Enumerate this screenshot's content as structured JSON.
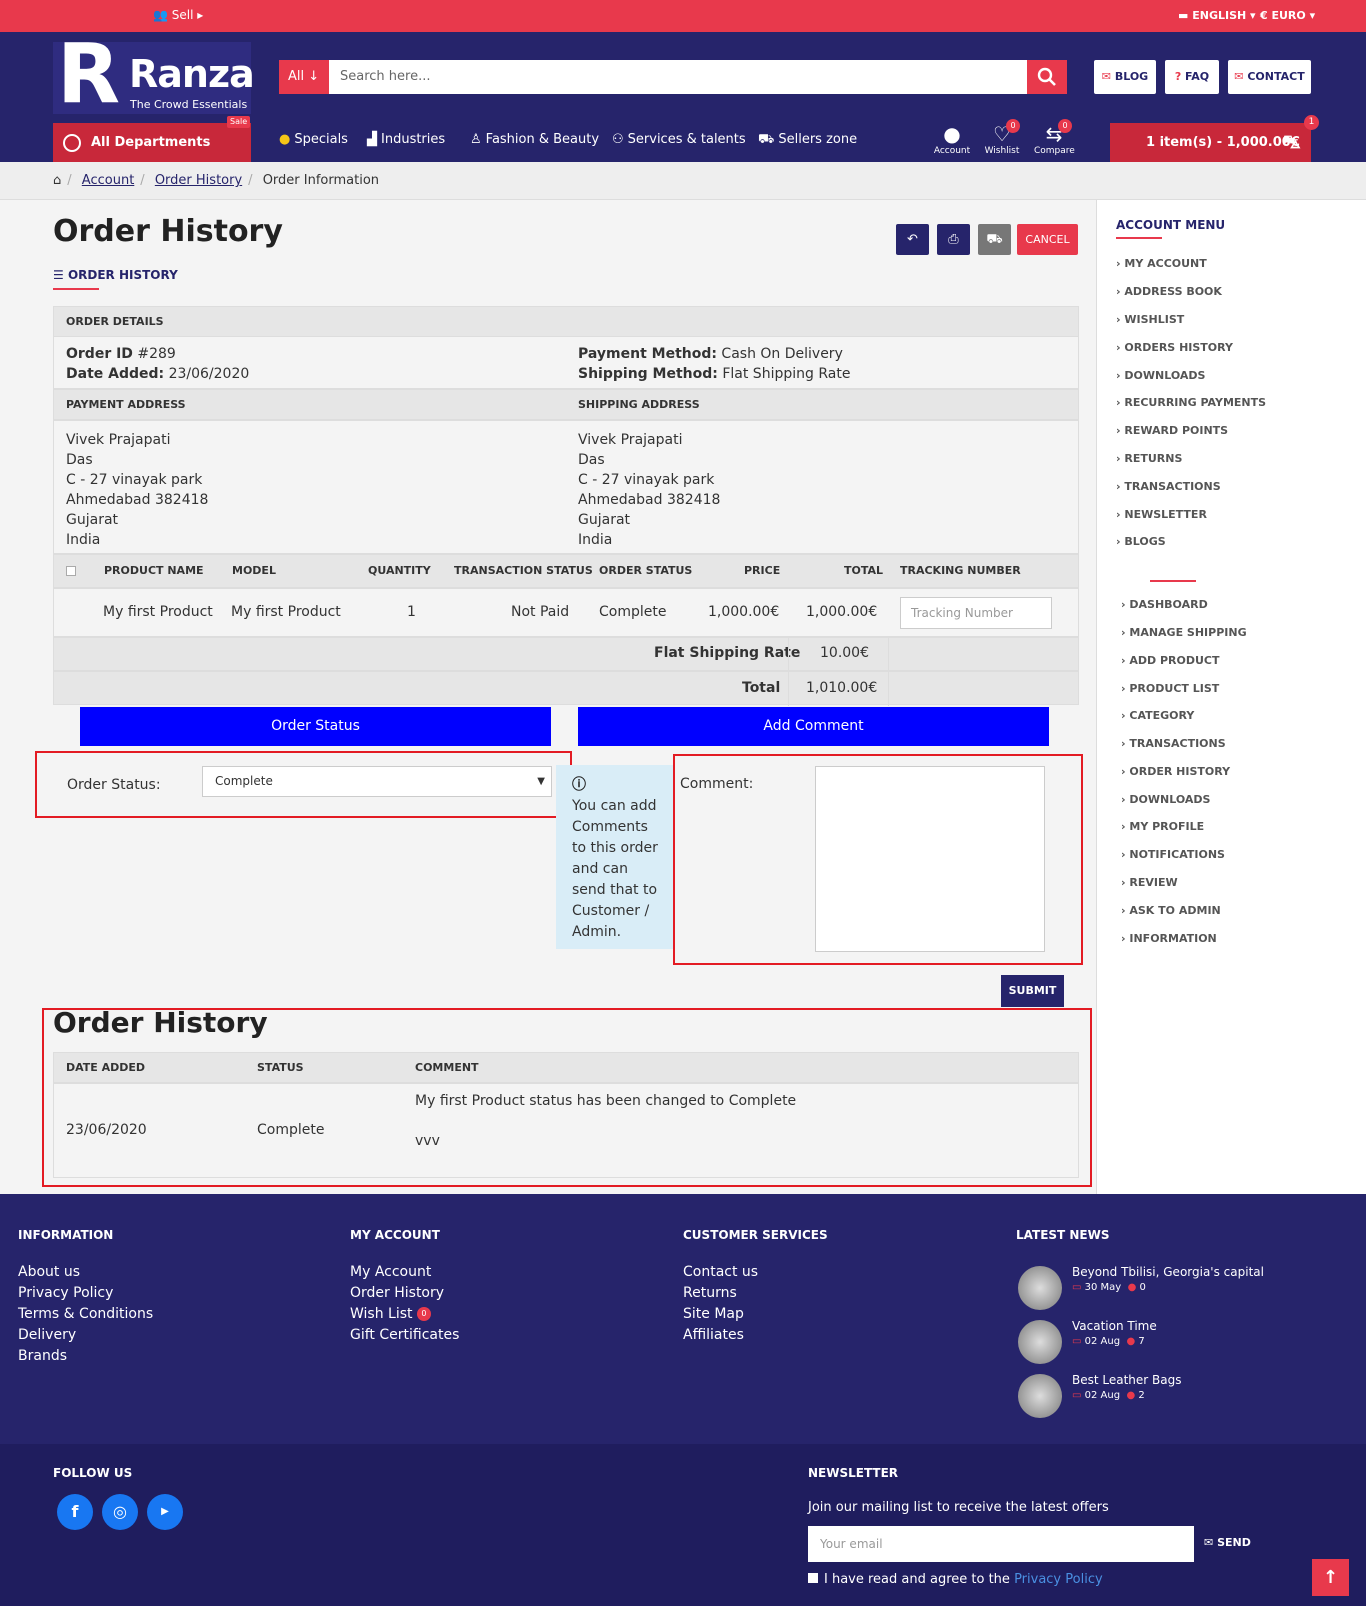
{
  "topbar": {
    "sell": "Sell",
    "language": "ENGLISH",
    "currency": "€ EURO"
  },
  "header": {
    "logo_letter": "R",
    "logo_name": "Ranza",
    "logo_tagline": "The Crowd Essentials",
    "search": {
      "category": "All",
      "placeholder": "Search here..."
    },
    "links": {
      "blog": "BLOG",
      "faq": "FAQ",
      "contact": "CONTACT"
    },
    "all_departments": "All Departments",
    "sale_badge": "Sale",
    "nav": [
      "Specials",
      "Industries",
      "Fashion & Beauty",
      "Services & talents",
      "Sellers zone"
    ],
    "account": "Account",
    "wishlist": "Wishlist",
    "wishlist_count": "0",
    "compare": "Compare",
    "compare_count": "0",
    "cart": "1 item(s) - 1,000.00€",
    "cart_count": "1"
  },
  "breadcrumb": [
    "Account",
    "Order History",
    "Order Information"
  ],
  "page": {
    "title": "Order History",
    "cancel": "CANCEL",
    "section": "ORDER HISTORY",
    "order_details": "ORDER DETAILS",
    "order_id_label": "Order ID",
    "order_id": "#289",
    "date_added_label": "Date Added:",
    "date_added": "23/06/2020",
    "payment_method_label": "Payment Method:",
    "payment_method": "Cash On Delivery",
    "shipping_method_label": "Shipping Method:",
    "shipping_method": "Flat Shipping Rate",
    "payment_address_h": "PAYMENT ADDRESS",
    "shipping_address_h": "SHIPPING ADDRESS",
    "payment_address": [
      "Vivek Prajapati",
      "Das",
      "C - 27 vinayak park",
      "Ahmedabad 382418",
      "Gujarat",
      "India"
    ],
    "shipping_address": [
      "Vivek Prajapati",
      "Das",
      "C - 27 vinayak park",
      "Ahmedabad 382418",
      "Gujarat",
      "India"
    ],
    "columns": [
      "PRODUCT NAME",
      "MODEL",
      "QUANTITY",
      "TRANSACTION STATUS",
      "ORDER STATUS",
      "PRICE",
      "TOTAL",
      "TRACKING NUMBER"
    ],
    "row": {
      "product": "My first Product",
      "model": "My first Product",
      "qty": "1",
      "transaction": "Not Paid",
      "status": "Complete",
      "price": "1,000.00€",
      "total": "1,000.00€",
      "tracking_placeholder": "Tracking Number"
    },
    "shipping_label": "Flat Shipping Rate",
    "shipping_value": "10.00€",
    "total_label": "Total",
    "total_value": "1,010.00€",
    "order_status_btn": "Order Status",
    "add_comment_btn": "Add Comment",
    "order_status_label": "Order Status:",
    "order_status_value": "Complete",
    "info_text": "You can add Comments to this order and can send that to Customer / Admin.",
    "comment_label": "Comment:",
    "submit": "SUBMIT",
    "history_title": "Order History",
    "history_columns": [
      "DATE ADDED",
      "STATUS",
      "COMMENT"
    ],
    "history_row": {
      "date": "23/06/2020",
      "status": "Complete",
      "comment1": "My first Product status has been changed to Complete",
      "comment2": "vvv"
    }
  },
  "sidebar": {
    "title": "ACCOUNT MENU",
    "items": [
      "MY ACCOUNT",
      "ADDRESS BOOK",
      "WISHLIST",
      "ORDERS HISTORY",
      "DOWNLOADS",
      "RECURRING PAYMENTS",
      "REWARD POINTS",
      "RETURNS",
      "TRANSACTIONS",
      "NEWSLETTER",
      "BLOGS"
    ],
    "seller_items": [
      "DASHBOARD",
      "MANAGE SHIPPING",
      "ADD PRODUCT",
      "PRODUCT LIST",
      "CATEGORY",
      "TRANSACTIONS",
      "ORDER HISTORY",
      "DOWNLOADS",
      "MY PROFILE",
      "NOTIFICATIONS",
      "REVIEW",
      "ASK TO ADMIN",
      "INFORMATION"
    ]
  },
  "footer": {
    "information": {
      "title": "INFORMATION",
      "links": [
        "About us",
        "Privacy Policy",
        "Terms & Conditions",
        "Delivery",
        "Brands"
      ]
    },
    "my_account": {
      "title": "MY ACCOUNT",
      "links": [
        "My Account",
        "Order History",
        "Wish List",
        "Gift Certificates"
      ],
      "wish_count": "0"
    },
    "customer": {
      "title": "CUSTOMER SERVICES",
      "links": [
        "Contact us",
        "Returns",
        "Site Map",
        "Affiliates"
      ]
    },
    "news": {
      "title": "LATEST NEWS",
      "items": [
        {
          "title": "Beyond Tbilisi, Georgia's capital",
          "date": "30 May",
          "comments": "0"
        },
        {
          "title": "Vacation Time",
          "date": "02 Aug",
          "comments": "7"
        },
        {
          "title": "Best Leather Bags",
          "date": "02 Aug",
          "comments": "2"
        }
      ]
    },
    "follow": "FOLLOW US",
    "newsletter": {
      "title": "NEWSLETTER",
      "text": "Join our mailing list to receive the latest offers",
      "placeholder": "Your email",
      "send": "SEND",
      "agree": "I have read and agree to the",
      "policy": "Privacy Policy"
    }
  },
  "colors": {
    "primary": "#26246b",
    "accent": "#e8394c",
    "blue_button": "#0000ff",
    "highlight": "#e31b23"
  }
}
